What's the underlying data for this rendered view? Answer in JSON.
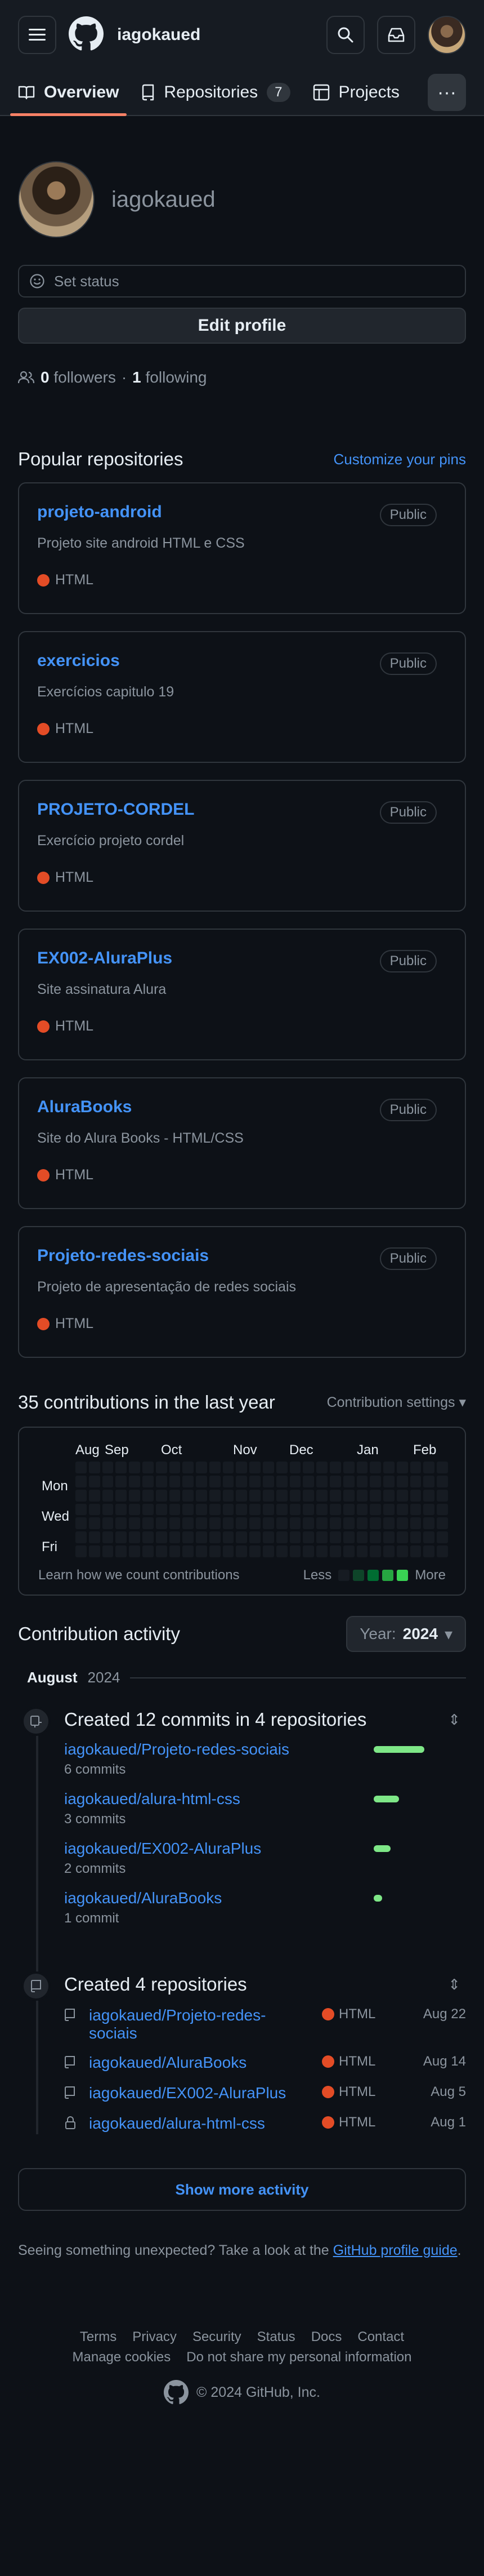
{
  "header": {
    "username": "iagokaued"
  },
  "nav": {
    "tabs": [
      {
        "label": "Overview"
      },
      {
        "label": "Repositories",
        "count": "7"
      },
      {
        "label": "Projects"
      }
    ],
    "more": "···"
  },
  "profile": {
    "login": "iagokaued",
    "status_label": "Set status",
    "edit_label": "Edit profile",
    "followers_count": "0",
    "followers_label": "followers",
    "separator": "·",
    "following_count": "1",
    "following_label": "following"
  },
  "popular": {
    "title": "Popular repositories",
    "customize": "Customize your pins",
    "repos": [
      {
        "name": "projeto-android",
        "badge": "Public",
        "desc": "Projeto site android HTML e CSS",
        "lang": "HTML"
      },
      {
        "name": "exercicios",
        "badge": "Public",
        "desc": "Exercícios capitulo 19",
        "lang": "HTML"
      },
      {
        "name": "PROJETO-CORDEL",
        "badge": "Public",
        "desc": "Exercício projeto cordel",
        "lang": "HTML"
      },
      {
        "name": "EX002-AluraPlus",
        "badge": "Public",
        "desc": "Site assinatura Alura",
        "lang": "HTML"
      },
      {
        "name": "AluraBooks",
        "badge": "Public",
        "desc": "Site do Alura Books - HTML/CSS",
        "lang": "HTML"
      },
      {
        "name": "Projeto-redes-sociais",
        "badge": "Public",
        "desc": "Projeto de apresentação de redes sociais",
        "lang": "HTML"
      }
    ]
  },
  "contributions": {
    "title": "35 contributions in the last year",
    "settings": "Contribution settings",
    "months": [
      "Aug",
      "Sep",
      "Oct",
      "Nov",
      "Dec",
      "Jan",
      "Feb"
    ],
    "days": [
      "Mon",
      "Wed",
      "Fri"
    ],
    "learn": "Learn how we count contributions",
    "less": "Less",
    "more": "More",
    "legend_colors": [
      "#161b22",
      "#0e4429",
      "#006d32",
      "#26a641",
      "#39d353"
    ]
  },
  "activity": {
    "title": "Contribution activity",
    "year_label": "Year:",
    "year_value": "2024",
    "month_name": "August",
    "month_year": "2024",
    "commits_title": "Created 12 commits in 4 repositories",
    "commits": [
      {
        "repo": "iagokaued/Projeto-redes-sociais",
        "count": "6 commits",
        "n": 6
      },
      {
        "repo": "iagokaued/alura-html-css",
        "count": "3 commits",
        "n": 3
      },
      {
        "repo": "iagokaued/EX002-AluraPlus",
        "count": "2 commits",
        "n": 2
      },
      {
        "repo": "iagokaued/AluraBooks",
        "count": "1 commit",
        "n": 1
      }
    ],
    "repos_title": "Created 4 repositories",
    "created": [
      {
        "repo": "iagokaued/Projeto-redes-sociais",
        "lang": "HTML",
        "date": "Aug 22",
        "icon": "repo-icon"
      },
      {
        "repo": "iagokaued/AluraBooks",
        "lang": "HTML",
        "date": "Aug 14",
        "icon": "repo-icon"
      },
      {
        "repo": "iagokaued/EX002-AluraPlus",
        "lang": "HTML",
        "date": "Aug 5",
        "icon": "repo-icon"
      },
      {
        "repo": "iagokaued/alura-html-css",
        "lang": "HTML",
        "date": "Aug 1",
        "icon": "lock-icon"
      }
    ],
    "show_more": "Show more activity",
    "unexpected_text": "Seeing something unexpected? Take a look at the",
    "unexpected_link": "GitHub profile guide",
    "unexpected_end": "."
  },
  "footer": {
    "links": [
      "Terms",
      "Privacy",
      "Security",
      "Status",
      "Docs",
      "Contact",
      "Manage cookies",
      "Do not share my personal information"
    ],
    "copyright": "© 2024 GitHub, Inc."
  },
  "colors": {
    "accent": "#4493f8",
    "html_lang": "#e34c26",
    "tab_underline": "#f78166",
    "commit_bar": "#7ee787"
  }
}
